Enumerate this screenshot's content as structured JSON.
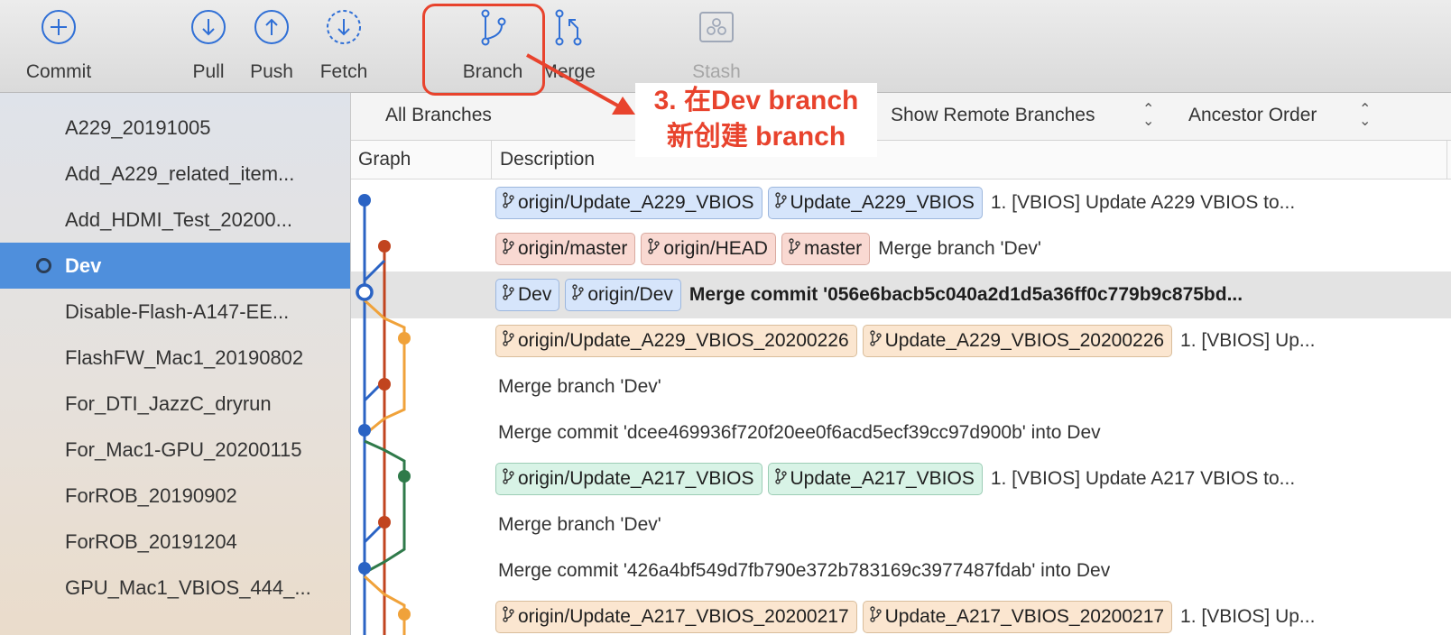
{
  "toolbar": {
    "commit": {
      "label": "Commit",
      "icon": "plus-circle-icon"
    },
    "pull": {
      "label": "Pull",
      "icon": "arrow-down-circle-icon"
    },
    "push": {
      "label": "Push",
      "icon": "arrow-up-circle-icon"
    },
    "fetch": {
      "label": "Fetch",
      "icon": "dashed-arrow-down-circle-icon"
    },
    "branch": {
      "label": "Branch",
      "icon": "branch-icon"
    },
    "merge": {
      "label": "Merge",
      "icon": "merge-icon"
    },
    "stash": {
      "label": "Stash",
      "icon": "stash-icon",
      "disabled": true
    }
  },
  "sidebar": {
    "items": [
      {
        "label": "A229_20191005"
      },
      {
        "label": "Add_A229_related_item..."
      },
      {
        "label": "Add_HDMI_Test_20200..."
      },
      {
        "label": "Dev",
        "selected": true
      },
      {
        "label": "Disable-Flash-A147-EE..."
      },
      {
        "label": "FlashFW_Mac1_20190802"
      },
      {
        "label": "For_DTI_JazzC_dryrun"
      },
      {
        "label": "For_Mac1-GPU_20200115"
      },
      {
        "label": "ForROB_20190902"
      },
      {
        "label": "ForROB_20191204"
      },
      {
        "label": "GPU_Mac1_VBIOS_444_..."
      }
    ]
  },
  "filterbar": {
    "branches": "All Branches",
    "remote": "Show Remote Branches",
    "order": "Ancestor Order"
  },
  "columns": {
    "graph": "Graph",
    "description": "Description"
  },
  "commits": [
    {
      "tags": [
        {
          "label": "origin/Update_A229_VBIOS",
          "color": "blue"
        },
        {
          "label": "Update_A229_VBIOS",
          "color": "blue"
        }
      ],
      "message": "1. [VBIOS] Update A229 VBIOS to..."
    },
    {
      "tags": [
        {
          "label": "origin/master",
          "color": "red"
        },
        {
          "label": "origin/HEAD",
          "color": "red"
        },
        {
          "label": "master",
          "color": "red"
        }
      ],
      "message": "Merge branch 'Dev'"
    },
    {
      "tags": [
        {
          "label": "Dev",
          "color": "blue"
        },
        {
          "label": "origin/Dev",
          "color": "blue"
        }
      ],
      "message": "Merge commit '056e6bacb5c040a2d1d5a36ff0c779b9c875bd...",
      "bold": true,
      "highlighted": true
    },
    {
      "tags": [
        {
          "label": "origin/Update_A229_VBIOS_20200226",
          "color": "orange"
        },
        {
          "label": "Update_A229_VBIOS_20200226",
          "color": "orange"
        }
      ],
      "message": "1. [VBIOS] Up..."
    },
    {
      "tags": [],
      "message": "Merge branch 'Dev'"
    },
    {
      "tags": [],
      "message": "Merge commit 'dcee469936f720f20ee0f6acd5ecf39cc97d900b' into Dev"
    },
    {
      "tags": [
        {
          "label": "origin/Update_A217_VBIOS",
          "color": "green"
        },
        {
          "label": "Update_A217_VBIOS",
          "color": "green"
        }
      ],
      "message": "1. [VBIOS] Update A217 VBIOS to..."
    },
    {
      "tags": [],
      "message": "Merge branch 'Dev'"
    },
    {
      "tags": [],
      "message": "Merge commit '426a4bf549d7fb790e372b783169c3977487fdab' into Dev"
    },
    {
      "tags": [
        {
          "label": "origin/Update_A217_VBIOS_20200217",
          "color": "orange"
        },
        {
          "label": "Update_A217_VBIOS_20200217",
          "color": "orange"
        }
      ],
      "message": "1. [VBIOS] Up..."
    }
  ],
  "annotation": {
    "line1": "3. 在Dev branch",
    "line2": "新创建 branch",
    "color": "#e8432d"
  },
  "colors": {
    "accent": "#4f8fdc",
    "icon_blue": "#2f6fd6",
    "graph_blue": "#2a63c4",
    "graph_red": "#c1441f",
    "graph_orange": "#f0a23a",
    "graph_green": "#2f7a4a"
  }
}
